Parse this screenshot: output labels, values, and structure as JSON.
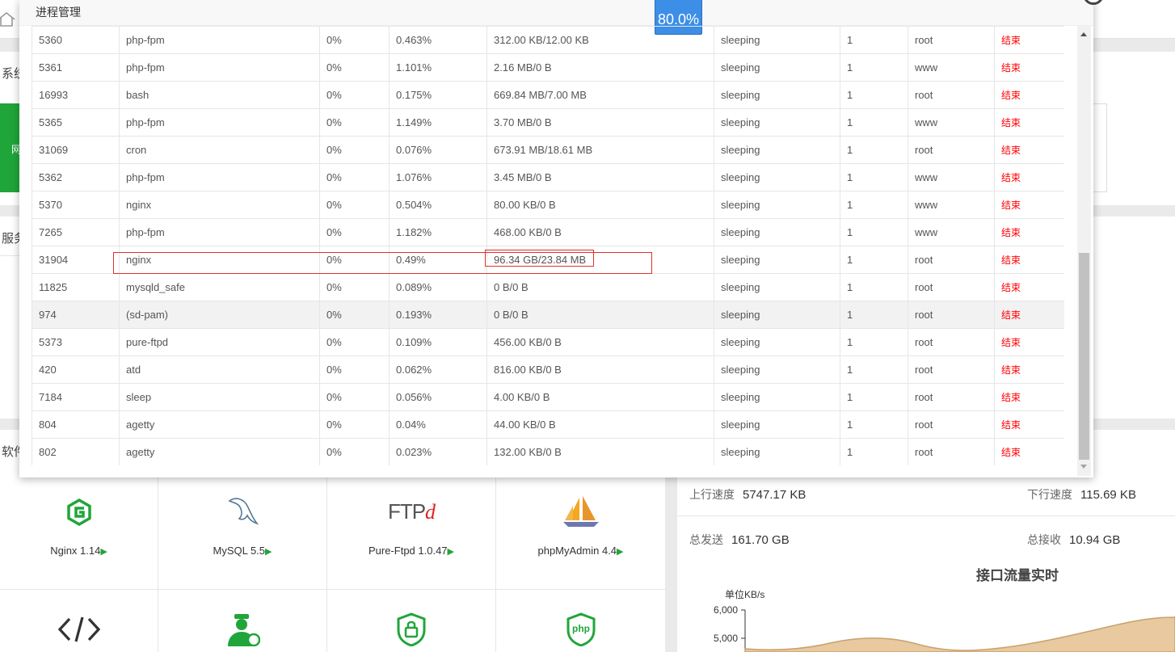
{
  "background": {
    "strips": [
      "系统",
      "服务",
      "软件"
    ],
    "green_tile_text": "网",
    "software": [
      {
        "name": "Nginx 1.14",
        "icon": "nginx-icon"
      },
      {
        "name": "MySQL 5.5",
        "icon": "mysql-icon"
      },
      {
        "name": "Pure-Ftpd 1.0.47",
        "icon": "ftpd-icon"
      },
      {
        "name": "phpMyAdmin 4.4",
        "icon": "phpmyadmin-icon"
      },
      {
        "name": "",
        "icon": "code-icon"
      },
      {
        "name": "",
        "icon": "admin-user-icon"
      },
      {
        "name": "",
        "icon": "lock-shield-icon"
      },
      {
        "name": "",
        "icon": "php-shield-icon"
      }
    ],
    "play_glyph": "▶",
    "ftpd_logo": "FTP",
    "ftpd_logo_d": "d",
    "php_logo": "php",
    "network": {
      "up_label": "上行速度",
      "up_value": "5747.17 KB",
      "down_label": "下行速度",
      "down_value": "115.69 KB",
      "sent_label": "总发送",
      "sent_value": "161.70 GB",
      "recv_label": "总接收",
      "recv_value": "10.94 GB",
      "chart_title": "接口流量实时",
      "unit": "单位KB/s",
      "ticks": [
        "6,000",
        "5,000"
      ]
    }
  },
  "modal": {
    "title": "进程管理",
    "progress": "80.0%",
    "kill_label": "结束",
    "rows": [
      {
        "pid": "5360",
        "name": "php-fpm",
        "cpu": "0%",
        "mem": "0.463%",
        "io": "312.00 KB/12.00 KB",
        "status": "sleeping",
        "threads": "1",
        "user": "root"
      },
      {
        "pid": "5361",
        "name": "php-fpm",
        "cpu": "0%",
        "mem": "1.101%",
        "io": "2.16 MB/0 B",
        "status": "sleeping",
        "threads": "1",
        "user": "www"
      },
      {
        "pid": "16993",
        "name": "bash",
        "cpu": "0%",
        "mem": "0.175%",
        "io": "669.84 MB/7.00 MB",
        "status": "sleeping",
        "threads": "1",
        "user": "root"
      },
      {
        "pid": "5365",
        "name": "php-fpm",
        "cpu": "0%",
        "mem": "1.149%",
        "io": "3.70 MB/0 B",
        "status": "sleeping",
        "threads": "1",
        "user": "www"
      },
      {
        "pid": "31069",
        "name": "cron",
        "cpu": "0%",
        "mem": "0.076%",
        "io": "673.91 MB/18.61 MB",
        "status": "sleeping",
        "threads": "1",
        "user": "root"
      },
      {
        "pid": "5362",
        "name": "php-fpm",
        "cpu": "0%",
        "mem": "1.076%",
        "io": "3.45 MB/0 B",
        "status": "sleeping",
        "threads": "1",
        "user": "www"
      },
      {
        "pid": "5370",
        "name": "nginx",
        "cpu": "0%",
        "mem": "0.504%",
        "io": "80.00 KB/0 B",
        "status": "sleeping",
        "threads": "1",
        "user": "www"
      },
      {
        "pid": "7265",
        "name": "php-fpm",
        "cpu": "0%",
        "mem": "1.182%",
        "io": "468.00 KB/0 B",
        "status": "sleeping",
        "threads": "1",
        "user": "www"
      },
      {
        "pid": "31904",
        "name": "nginx",
        "cpu": "0%",
        "mem": "0.49%",
        "io": "96.34 GB/23.84 MB",
        "status": "sleeping",
        "threads": "1",
        "user": "root"
      },
      {
        "pid": "11825",
        "name": "mysqld_safe",
        "cpu": "0%",
        "mem": "0.089%",
        "io": "0 B/0 B",
        "status": "sleeping",
        "threads": "1",
        "user": "root"
      },
      {
        "pid": "974",
        "name": "(sd-pam)",
        "cpu": "0%",
        "mem": "0.193%",
        "io": "0 B/0 B",
        "status": "sleeping",
        "threads": "1",
        "user": "root"
      },
      {
        "pid": "5373",
        "name": "pure-ftpd",
        "cpu": "0%",
        "mem": "0.109%",
        "io": "456.00 KB/0 B",
        "status": "sleeping",
        "threads": "1",
        "user": "root"
      },
      {
        "pid": "420",
        "name": "atd",
        "cpu": "0%",
        "mem": "0.062%",
        "io": "816.00 KB/0 B",
        "status": "sleeping",
        "threads": "1",
        "user": "root"
      },
      {
        "pid": "7184",
        "name": "sleep",
        "cpu": "0%",
        "mem": "0.056%",
        "io": "4.00 KB/0 B",
        "status": "sleeping",
        "threads": "1",
        "user": "root"
      },
      {
        "pid": "804",
        "name": "agetty",
        "cpu": "0%",
        "mem": "0.04%",
        "io": "44.00 KB/0 B",
        "status": "sleeping",
        "threads": "1",
        "user": "root"
      },
      {
        "pid": "802",
        "name": "agetty",
        "cpu": "0%",
        "mem": "0.023%",
        "io": "132.00 KB/0 B",
        "status": "sleeping",
        "threads": "1",
        "user": "root"
      }
    ],
    "hovered_row": 10
  },
  "colors": {
    "accent_green": "#20a53a",
    "kill_red": "#ff0000",
    "progress_blue": "#3c8ee6",
    "annotation_red": "#e0302a"
  }
}
